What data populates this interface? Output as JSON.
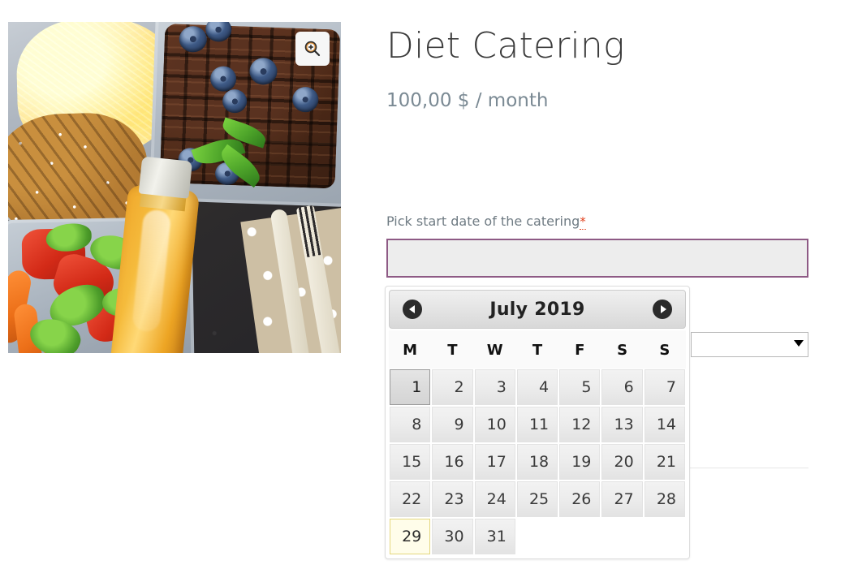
{
  "gallery": {
    "zoom_icon": "magnifier-plus-icon",
    "image_alt": "Meal prep containers with rice, chicken, chocolate waffles with blueberries, vegetables and orange juice"
  },
  "product": {
    "title": "Diet Catering",
    "price": "100,00 $ / month"
  },
  "form": {
    "date_label": "Pick start date of the catering",
    "required_marker": "*",
    "date_value": "",
    "date_placeholder": "",
    "variation_value": "",
    "variation_options": [
      ""
    ]
  },
  "datepicker": {
    "month_year": "July 2019",
    "prev_label": "Prev",
    "next_label": "Next",
    "day_headers": [
      "M",
      "T",
      "W",
      "T",
      "F",
      "S",
      "S"
    ],
    "weeks": [
      [
        {
          "n": "1",
          "state": "hover"
        },
        {
          "n": "2",
          "state": "normal"
        },
        {
          "n": "3",
          "state": "normal"
        },
        {
          "n": "4",
          "state": "normal"
        },
        {
          "n": "5",
          "state": "normal"
        },
        {
          "n": "6",
          "state": "normal"
        },
        {
          "n": "7",
          "state": "normal"
        }
      ],
      [
        {
          "n": "8",
          "state": "normal"
        },
        {
          "n": "9",
          "state": "normal"
        },
        {
          "n": "10",
          "state": "normal"
        },
        {
          "n": "11",
          "state": "normal"
        },
        {
          "n": "12",
          "state": "normal"
        },
        {
          "n": "13",
          "state": "normal"
        },
        {
          "n": "14",
          "state": "normal"
        }
      ],
      [
        {
          "n": "15",
          "state": "normal"
        },
        {
          "n": "16",
          "state": "normal"
        },
        {
          "n": "17",
          "state": "normal"
        },
        {
          "n": "18",
          "state": "normal"
        },
        {
          "n": "19",
          "state": "normal"
        },
        {
          "n": "20",
          "state": "normal"
        },
        {
          "n": "21",
          "state": "normal"
        }
      ],
      [
        {
          "n": "22",
          "state": "normal"
        },
        {
          "n": "23",
          "state": "normal"
        },
        {
          "n": "24",
          "state": "normal"
        },
        {
          "n": "25",
          "state": "normal"
        },
        {
          "n": "26",
          "state": "normal"
        },
        {
          "n": "27",
          "state": "normal"
        },
        {
          "n": "28",
          "state": "normal"
        }
      ],
      [
        {
          "n": "29",
          "state": "today"
        },
        {
          "n": "30",
          "state": "normal"
        },
        {
          "n": "31",
          "state": "normal"
        },
        {
          "n": "",
          "state": "empty"
        },
        {
          "n": "",
          "state": "empty"
        },
        {
          "n": "",
          "state": "empty"
        },
        {
          "n": "",
          "state": "empty"
        }
      ]
    ]
  },
  "colors": {
    "accent_border": "#8e5a85",
    "required": "#e2401c",
    "price_text": "#7b8a94",
    "title_text": "#3c3c3c",
    "today_bg": "#fffdea",
    "today_border": "#e4d77e"
  }
}
